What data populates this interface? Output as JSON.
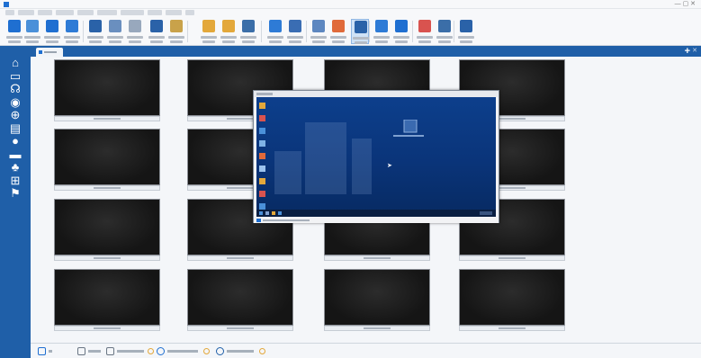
{
  "window": {
    "title": "",
    "controls": "— ▢ ✕"
  },
  "menubar": {
    "items": [
      "",
      "",
      "",
      "",
      "",
      "",
      "",
      "",
      "",
      ""
    ]
  },
  "ribbon": {
    "buttons": [
      {
        "icon": "monitor-student-icon",
        "color": "#1f6fd1",
        "active": false
      },
      {
        "icon": "grid-view-icon",
        "color": "#4a90d9",
        "active": false
      },
      {
        "icon": "register-icon",
        "color": "#1f6fd1",
        "active": false
      },
      {
        "icon": "students-icon",
        "color": "#2e7bd6",
        "active": false
      },
      {
        "icon": "show-icon",
        "color": "#2a62a8",
        "active": false
      },
      {
        "icon": "transfer-icon",
        "color": "#6a8fbf",
        "active": false
      },
      {
        "icon": "share-icon",
        "color": "#98a8bd",
        "active": false
      },
      {
        "icon": "transfer-files-icon",
        "color": "#2a62a8",
        "active": false
      },
      {
        "icon": "folder-icon",
        "color": "#c9a24a",
        "active": false
      },
      {
        "icon": "lock-icon",
        "color": "#e3a83b",
        "active": false
      },
      {
        "icon": "unlock-icon",
        "color": "#e3a83b",
        "active": false
      },
      {
        "icon": "screen-off-icon",
        "color": "#3b6ea8",
        "active": false
      },
      {
        "icon": "web-icon",
        "color": "#2e7bd6",
        "active": false
      },
      {
        "icon": "apps-icon",
        "color": "#3a6db3",
        "active": false
      },
      {
        "icon": "chat-icon",
        "color": "#5d87c0",
        "active": false
      },
      {
        "icon": "help-icon",
        "color": "#e06a3a",
        "active": false
      },
      {
        "icon": "view-icon",
        "color": "#2a62a8",
        "active": true
      },
      {
        "icon": "survey-icon",
        "color": "#2e7bd6",
        "active": false
      },
      {
        "icon": "send-icon",
        "color": "#1f6fd1",
        "active": false
      },
      {
        "icon": "quiz-icon",
        "color": "#d9534f",
        "active": false
      },
      {
        "icon": "book-icon",
        "color": "#3b6ea8",
        "active": false
      },
      {
        "icon": "tutor-icon",
        "color": "#2a62a8",
        "active": false
      }
    ]
  },
  "tabs": [
    {
      "label": ""
    }
  ],
  "sidebar": {
    "items": [
      {
        "icon": "home-icon",
        "glyph": "⌂"
      },
      {
        "icon": "monitor-icon",
        "glyph": "▭"
      },
      {
        "icon": "headset-icon",
        "glyph": "☊"
      },
      {
        "icon": "globe-icon",
        "glyph": "◉"
      },
      {
        "icon": "network-icon",
        "glyph": "⊕"
      },
      {
        "icon": "document-icon",
        "glyph": "▤"
      },
      {
        "icon": "info-icon",
        "glyph": "●"
      },
      {
        "icon": "printer-icon",
        "glyph": "▬"
      },
      {
        "icon": "users-icon",
        "glyph": "♣"
      },
      {
        "icon": "apps-grid-icon",
        "glyph": "⊞"
      },
      {
        "icon": "flag-icon",
        "glyph": "⚑"
      }
    ]
  },
  "remote_viewer": {
    "title": "",
    "status": ""
  },
  "bottombar": {
    "items": [
      {
        "icon": "monitor-small-icon",
        "label": ""
      },
      {
        "icon": "zoom-icon",
        "label": ""
      },
      {
        "icon": "apps-icon",
        "label": ""
      },
      {
        "icon": "web-icon",
        "label": ""
      },
      {
        "icon": "sound-icon",
        "label": ""
      }
    ]
  }
}
